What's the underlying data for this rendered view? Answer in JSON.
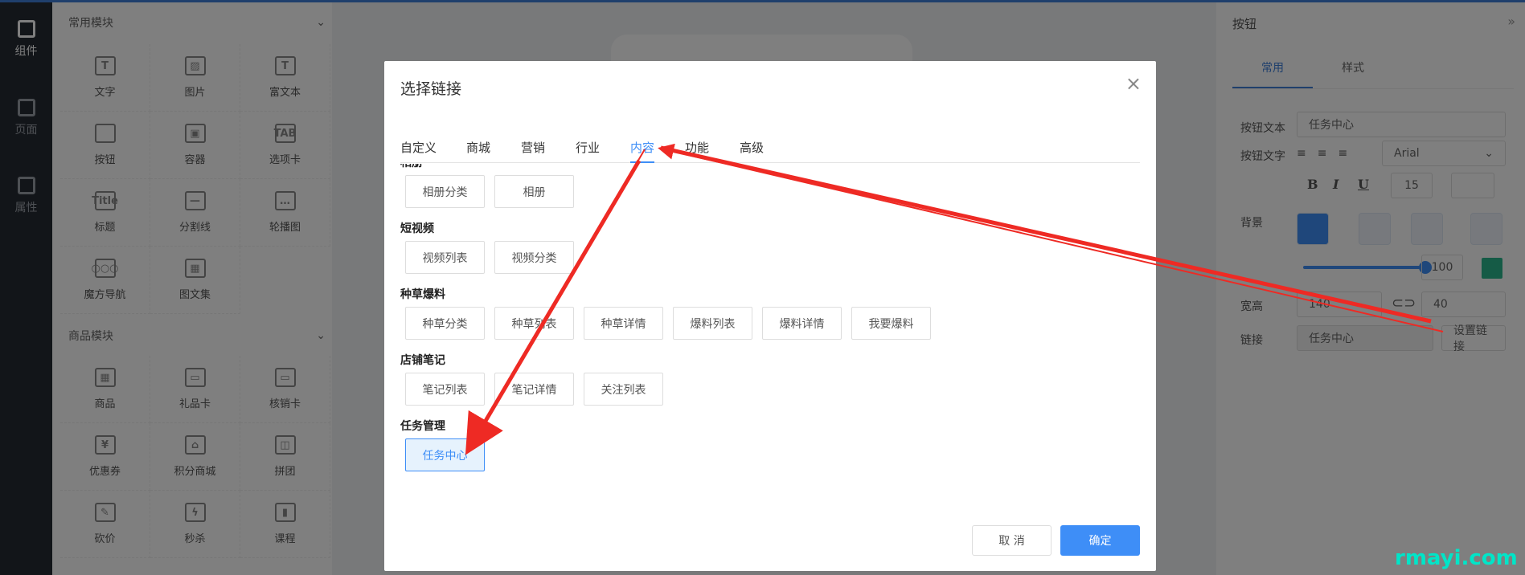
{
  "rail": {
    "items": [
      {
        "label": "组件",
        "icon": "component-icon"
      },
      {
        "label": "页面",
        "icon": "page-icon"
      },
      {
        "label": "属性",
        "icon": "attr-icon"
      }
    ]
  },
  "library": {
    "common_title": "常用模块",
    "common": [
      {
        "label": "文字",
        "glyph": "T"
      },
      {
        "label": "图片",
        "glyph": "▨"
      },
      {
        "label": "富文本",
        "glyph": "T"
      },
      {
        "label": "按钮",
        "glyph": ""
      },
      {
        "label": "容器",
        "glyph": "▣"
      },
      {
        "label": "选项卡",
        "glyph": "TAB"
      },
      {
        "label": "标题",
        "glyph": "Title"
      },
      {
        "label": "分割线",
        "glyph": "—"
      },
      {
        "label": "轮播图",
        "glyph": "…"
      },
      {
        "label": "魔方导航",
        "glyph": "○○○"
      },
      {
        "label": "图文集",
        "glyph": "▦"
      }
    ],
    "goods_title": "商品模块",
    "goods": [
      {
        "label": "商品",
        "glyph": "▦"
      },
      {
        "label": "礼品卡",
        "glyph": "▭"
      },
      {
        "label": "核销卡",
        "glyph": "▭"
      },
      {
        "label": "优惠券",
        "glyph": "¥"
      },
      {
        "label": "积分商城",
        "glyph": "⌂"
      },
      {
        "label": "拼团",
        "glyph": "◫"
      },
      {
        "label": "砍价",
        "glyph": "✎"
      },
      {
        "label": "秒杀",
        "glyph": "ϟ"
      },
      {
        "label": "课程",
        "glyph": "▮"
      }
    ]
  },
  "props": {
    "title": "按钮",
    "tabs": [
      "常用",
      "样式"
    ],
    "text_label": "按钮文本",
    "text_value": "任务中心",
    "font_label": "按钮文字",
    "font_value": "Arial",
    "font_size": "15",
    "bg_label": "背景",
    "opacity": "100",
    "size_label": "宽高",
    "width": "140",
    "height": "40",
    "link_label": "链接",
    "link_value": "任务中心",
    "link_button": "设置链接",
    "bold": "B",
    "italic": "I",
    "underline": "U"
  },
  "modal": {
    "title": "选择链接",
    "tabs": [
      "自定义",
      "商城",
      "营销",
      "行业",
      "内容",
      "功能",
      "高级"
    ],
    "active_tab": "内容",
    "groups": [
      {
        "title": "相册",
        "items": [
          "相册分类",
          "相册"
        ]
      },
      {
        "title": "短视频",
        "items": [
          "视频列表",
          "视频分类"
        ]
      },
      {
        "title": "种草爆料",
        "items": [
          "种草分类",
          "种草列表",
          "种草详情",
          "爆料列表",
          "爆料详情",
          "我要爆料"
        ]
      },
      {
        "title": "店铺笔记",
        "items": [
          "笔记列表",
          "笔记详情",
          "关注列表"
        ]
      },
      {
        "title": "任务管理",
        "items": [
          "任务中心"
        ]
      }
    ],
    "selected": "任务中心",
    "cancel": "取 消",
    "confirm": "确定"
  },
  "watermark": "rmayi.com",
  "colors": {
    "accent": "#3e8ef7",
    "arrow": "#ee2a24"
  }
}
